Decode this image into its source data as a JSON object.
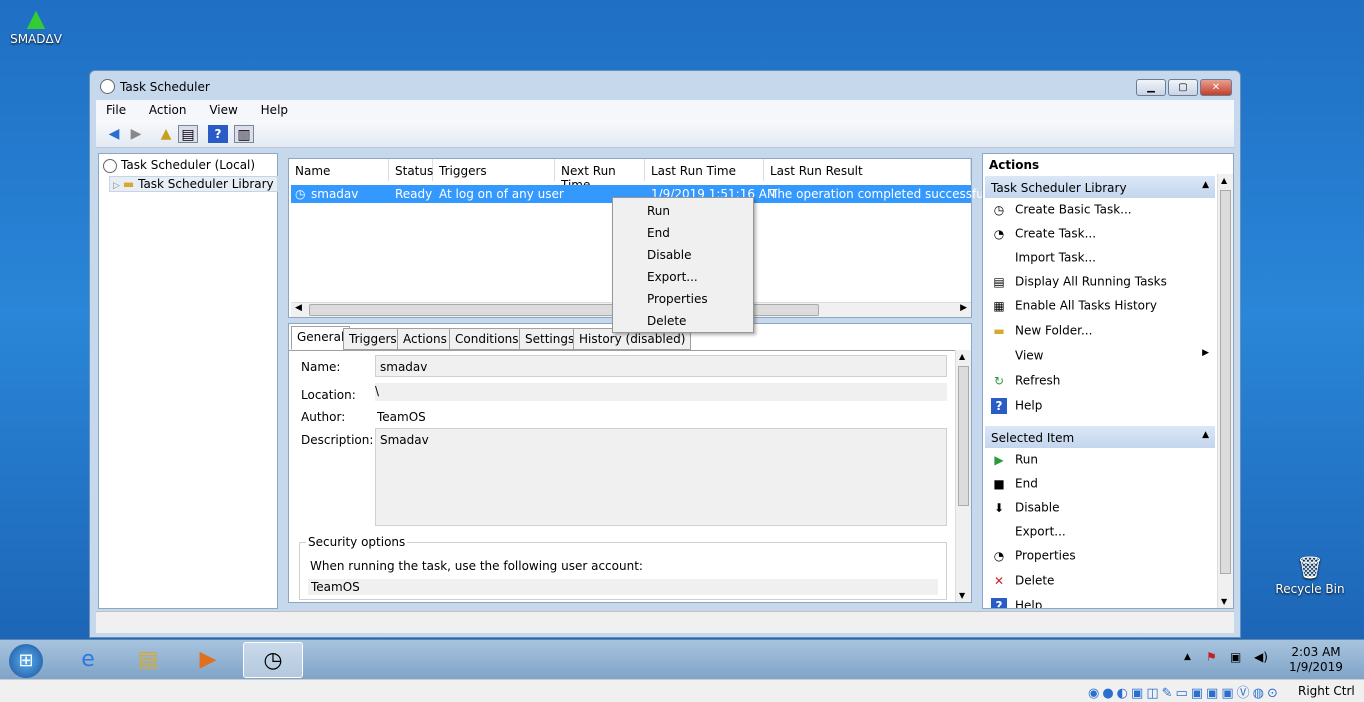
{
  "desktop": {
    "smadav_label": "SMADΔV",
    "recycle_label": "Recycle Bin"
  },
  "window": {
    "title": "Task Scheduler",
    "min": "▁",
    "max": "▢",
    "close": "✕"
  },
  "menu": [
    "File",
    "Action",
    "View",
    "Help"
  ],
  "tree": {
    "root": "Task Scheduler (Local)",
    "child": "Task Scheduler Library"
  },
  "list": {
    "columns": [
      "Name",
      "Status",
      "Triggers",
      "Next Run Time",
      "Last Run Time",
      "Last Run Result"
    ],
    "row": {
      "name": "smadav",
      "status": "Ready",
      "triggers": "At log on of any user",
      "next": "",
      "last": "1/9/2019 1:51:16 AM",
      "result": "The operation completed successfully."
    }
  },
  "context_menu": [
    "Run",
    "End",
    "Disable",
    "Export...",
    "Properties",
    "Delete"
  ],
  "tabs": [
    "General",
    "Triggers",
    "Actions",
    "Conditions",
    "Settings",
    "History (disabled)"
  ],
  "general": {
    "name_label": "Name:",
    "name_value": "smadav",
    "location_label": "Location:",
    "location_value": "\\",
    "author_label": "Author:",
    "author_value": "TeamOS",
    "description_label": "Description:",
    "description_value": "Smadav",
    "security_title": "Security options",
    "security_text": "When running the task, use the following user account:",
    "security_account": "TeamOS"
  },
  "actions": {
    "title": "Actions",
    "library_header": "Task Scheduler Library",
    "library_items": [
      "Create Basic Task...",
      "Create Task...",
      "Import Task...",
      "Display All Running Tasks",
      "Enable All Tasks History",
      "New Folder...",
      "View",
      "Refresh",
      "Help"
    ],
    "selected_header": "Selected Item",
    "selected_items": [
      "Run",
      "End",
      "Disable",
      "Export...",
      "Properties",
      "Delete",
      "Help"
    ]
  },
  "tray": {
    "time": "2:03 AM",
    "date": "1/9/2019",
    "host_key": "Right Ctrl"
  }
}
